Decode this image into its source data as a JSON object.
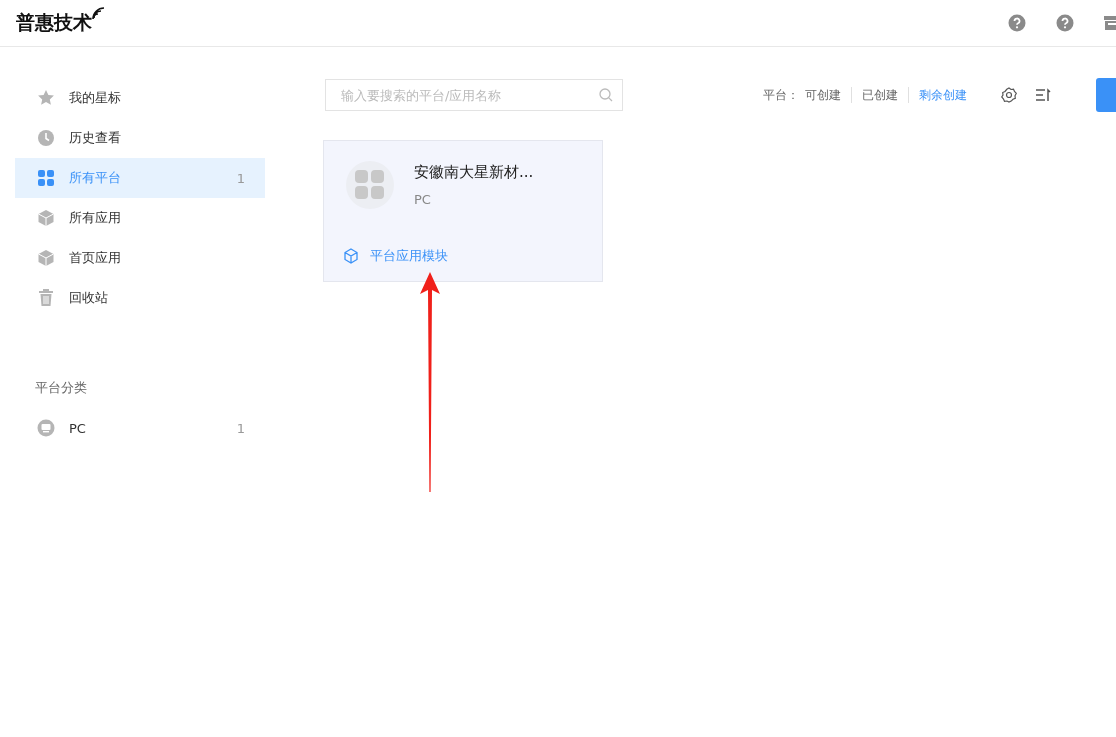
{
  "header": {
    "logo": "普惠技术"
  },
  "sidebar": {
    "items": [
      {
        "label": "我的星标",
        "selected": false
      },
      {
        "label": "历史查看",
        "selected": false
      },
      {
        "label": "所有平台",
        "count": "1",
        "selected": true
      },
      {
        "label": "所有应用",
        "selected": false
      },
      {
        "label": "首页应用",
        "selected": false
      },
      {
        "label": "回收站",
        "selected": false
      }
    ],
    "section_title": "平台分类",
    "categories": [
      {
        "label": "PC",
        "count": "1",
        "selected": false
      }
    ]
  },
  "search": {
    "placeholder": "输入要搜索的平台/应用名称"
  },
  "filter": {
    "label": "平台：",
    "options": [
      {
        "label": "可创建",
        "selected": false
      },
      {
        "label": "已创建",
        "selected": false
      },
      {
        "label": "剩余创建",
        "selected": true
      }
    ]
  },
  "cards": [
    {
      "title": "安徽南大星新材...",
      "subtitle": "PC",
      "link": "平台应用模块"
    }
  ]
}
